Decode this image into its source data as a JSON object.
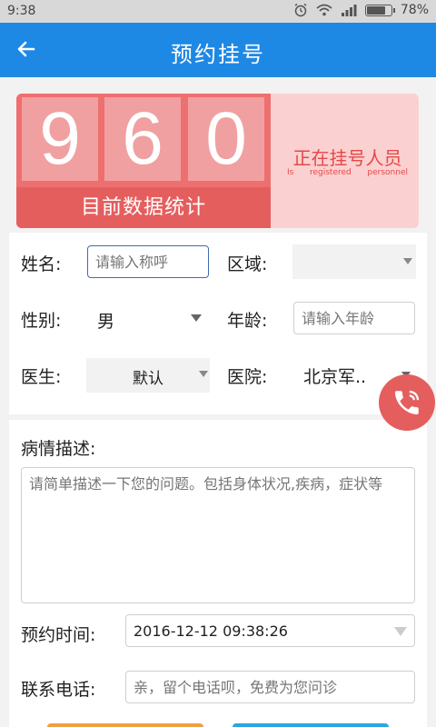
{
  "status_bar": {
    "time": "9:38",
    "battery_percent": "78%",
    "battery_level": 0.78
  },
  "app_bar": {
    "title": "预约挂号",
    "back_icon": "arrow-left-icon"
  },
  "banner": {
    "digits": [
      "9",
      "6",
      "0"
    ],
    "stats_label": "目前数据统计",
    "registering_cn": "正在挂号人员",
    "registering_en": [
      "Is",
      "registered",
      "personnel"
    ]
  },
  "form": {
    "name": {
      "label": "姓名:",
      "placeholder": "请输入称呼"
    },
    "region": {
      "label": "区域:",
      "value": ""
    },
    "gender": {
      "label": "性别:",
      "value": "男"
    },
    "age": {
      "label": "年龄:",
      "placeholder": "请输入年龄"
    },
    "doctor": {
      "label": "医生:",
      "value": "默认"
    },
    "hospital": {
      "label": "医院:",
      "value": "北京军.."
    },
    "description": {
      "label": "病情描述:",
      "placeholder": "请简单描述一下您的问题。包括身体状况,疾病，症状等"
    },
    "appointment_time": {
      "label": "预约时间:",
      "value": "2016-12-12 09:38:26"
    },
    "phone": {
      "label": "联系电话:",
      "placeholder": "亲，留个电话呗，免费为您问诊"
    }
  },
  "colors": {
    "primary": "#1e88e5",
    "accent_red": "#e55e5e",
    "banner_bg": "#fbd0d0"
  }
}
